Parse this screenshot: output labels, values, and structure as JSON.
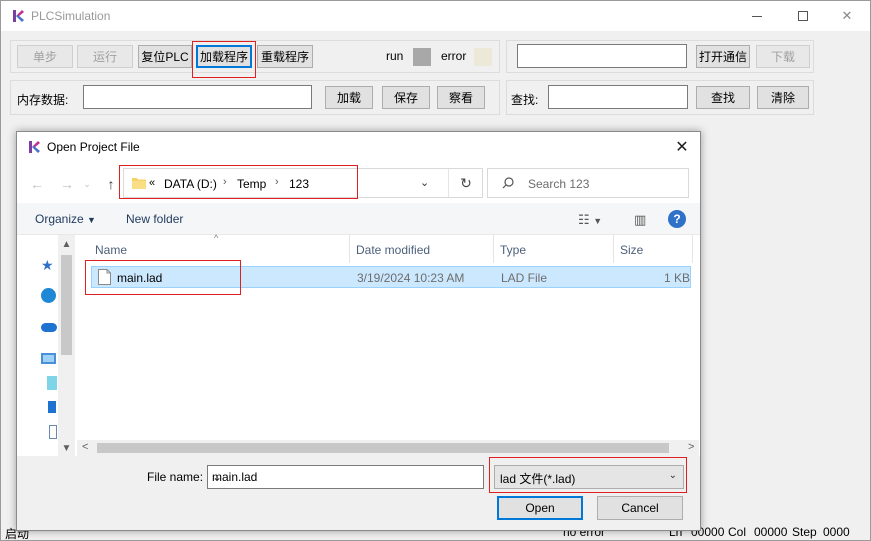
{
  "app": {
    "title": "PLCSimulation",
    "toolbar": {
      "step_label": "单步",
      "run_label": "运行",
      "reset_plc_label": "复位PLC",
      "load_program_label": "加载程序",
      "reload_program_label": "重载程序",
      "run_indicator_label": "run",
      "error_indicator_label": "error",
      "open_comm_label": "打开通信",
      "download_label": "下载",
      "comm_input_value": ""
    },
    "memory": {
      "label": "内存数据:",
      "value": "",
      "load_label": "加载",
      "save_label": "保存",
      "view_label": "察看"
    },
    "find": {
      "label": "查找:",
      "value": "",
      "find_label": "查找",
      "clear_label": "清除"
    },
    "status": {
      "left": "启动",
      "error": "no error",
      "ln_label": "Ln",
      "ln_value": "00000",
      "col_label": "Col",
      "col_value": "00000",
      "step_label": "Step",
      "step_value": "0000"
    },
    "colors": {
      "run_led": "#a8a8a8",
      "error_led": "#ece9d8",
      "highlight": "#e02020"
    }
  },
  "dialog": {
    "title": "Open Project File",
    "breadcrumb": {
      "overflow": "«",
      "items": [
        "DATA (D:)",
        "Temp",
        "123"
      ]
    },
    "search_placeholder": "Search 123",
    "commands": {
      "organize": "Organize",
      "new_folder": "New folder"
    },
    "columns": {
      "name": "Name",
      "date_modified": "Date modified",
      "type": "Type",
      "size": "Size"
    },
    "files": [
      {
        "name": "main.lad",
        "date_modified": "3/19/2024 10:23 AM",
        "type": "LAD File",
        "size": "1 KB"
      }
    ],
    "footer": {
      "file_name_label": "File name:",
      "file_name_value": "main.lad",
      "filter_value": "lad 文件(*.lad)",
      "open_label": "Open",
      "cancel_label": "Cancel"
    }
  }
}
